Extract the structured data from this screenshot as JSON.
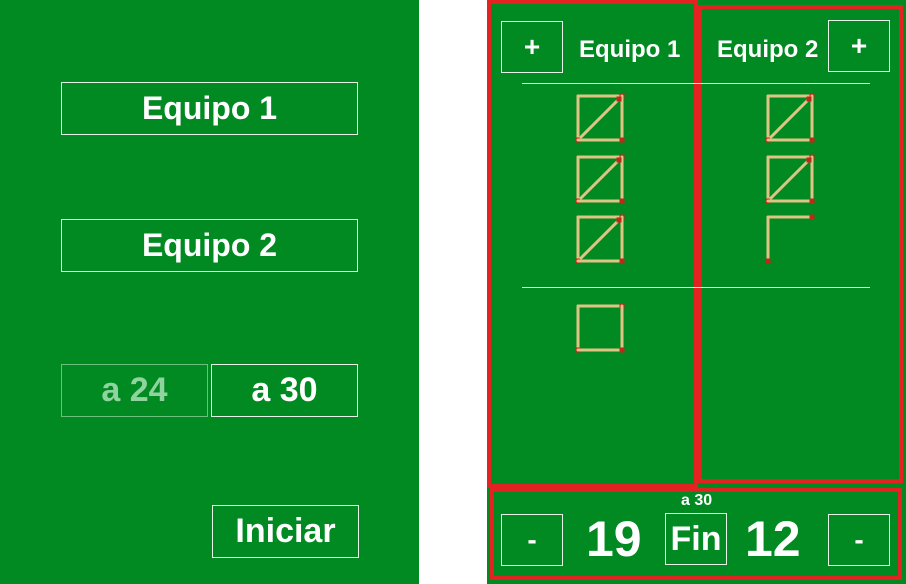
{
  "setup": {
    "team1_button": "Equipo 1",
    "team2_button": "Equipo 2",
    "target_options": [
      {
        "label": "a 24",
        "selected": false
      },
      {
        "label": "a 30",
        "selected": true
      }
    ],
    "start_button": "Iniciar"
  },
  "scoreboard": {
    "team1": {
      "name": "Equipo 1",
      "add_label": "+",
      "subtract_label": "-",
      "score": "19"
    },
    "team2": {
      "name": "Equipo 2",
      "add_label": "+",
      "subtract_label": "-",
      "score": "12"
    },
    "target_label": "a 30",
    "end_button": "Fin"
  },
  "tally": {
    "team1_groups": [
      5,
      5,
      5,
      4
    ],
    "team2_groups": [
      5,
      5,
      2
    ]
  },
  "colors": {
    "background": "#008a21",
    "highlight": "#e32222",
    "match_wood": "#e0c483",
    "match_head": "#c0281c"
  }
}
